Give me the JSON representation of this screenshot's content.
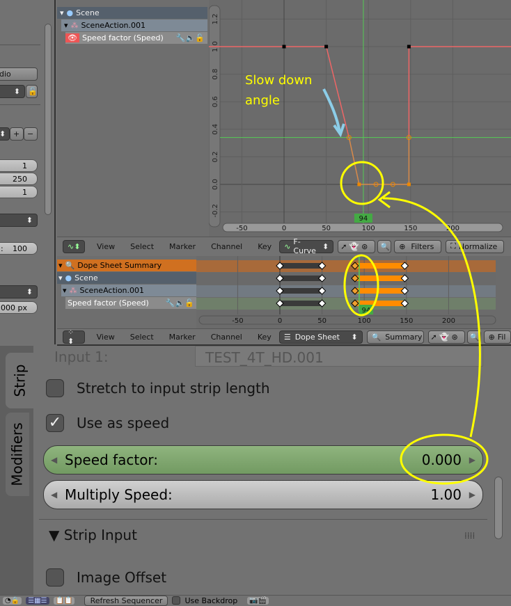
{
  "left_panel": {
    "button_partial": "dio",
    "fields": [
      "1",
      "250",
      "1"
    ],
    "field_partial_label": ":",
    "field_partial_value": "100",
    "px_value": ".000 px"
  },
  "graph_editor": {
    "channels": [
      {
        "label": "Scene"
      },
      {
        "label": "SceneAction.001"
      },
      {
        "label": "Speed factor (Speed)"
      }
    ],
    "y_ticks": [
      "1.2",
      "1.0",
      "0.8",
      "0.6",
      "0.4",
      "0.2",
      "0.0",
      "-0.2"
    ],
    "x_ticks": [
      "-50",
      "0",
      "50",
      "100",
      "150",
      "200"
    ],
    "current_frame": "94",
    "keyframes": [
      [
        0,
        1
      ],
      [
        50,
        1
      ],
      [
        89,
        0
      ],
      [
        109,
        0
      ],
      [
        129,
        0
      ],
      [
        148,
        0
      ],
      [
        148,
        1
      ]
    ],
    "handles": [
      [
        77,
        0.34
      ],
      [
        148,
        0.34
      ]
    ],
    "header": {
      "menus": [
        "View",
        "Select",
        "Marker",
        "Channel",
        "Key"
      ],
      "mode": "F-Curve",
      "filters": "Filters",
      "normalize": "Normalize"
    }
  },
  "dope_sheet": {
    "channels": [
      {
        "label": "Dope Sheet Summary"
      },
      {
        "label": "Scene"
      },
      {
        "label": "SceneAction.001"
      },
      {
        "label": "Speed factor (Speed)"
      }
    ],
    "x_ticks": [
      "-50",
      "0",
      "50",
      "100",
      "150",
      "200"
    ],
    "current_frame": "94",
    "keys": [
      0,
      50,
      89,
      148
    ],
    "header": {
      "menus": [
        "View",
        "Select",
        "Marker",
        "Channel",
        "Key"
      ],
      "mode": "Dope Sheet",
      "summary": "Summary",
      "filters": "Fil"
    }
  },
  "strip_panel": {
    "tabs": [
      "Strip",
      "Modifiers"
    ],
    "input_label": "Input 1:",
    "input_value": "TEST_4T_HD.001",
    "stretch_label": "Stretch to input strip length",
    "stretch_checked": false,
    "use_speed_label": "Use as speed",
    "use_speed_checked": true,
    "speed_factor_label": "Speed factor:",
    "speed_factor_value": "0.000",
    "multiply_label": "Multiply Speed:",
    "multiply_value": "1.00",
    "section": "Strip Input",
    "image_offset_label": "Image Offset",
    "image_offset_checked": false
  },
  "bottom_bar": {
    "refresh": "Refresh Sequencer",
    "backdrop": "Use Backdrop"
  },
  "annotation": {
    "text_line1": "Slow down",
    "text_line2": "angle",
    "color": "#ffff00"
  }
}
